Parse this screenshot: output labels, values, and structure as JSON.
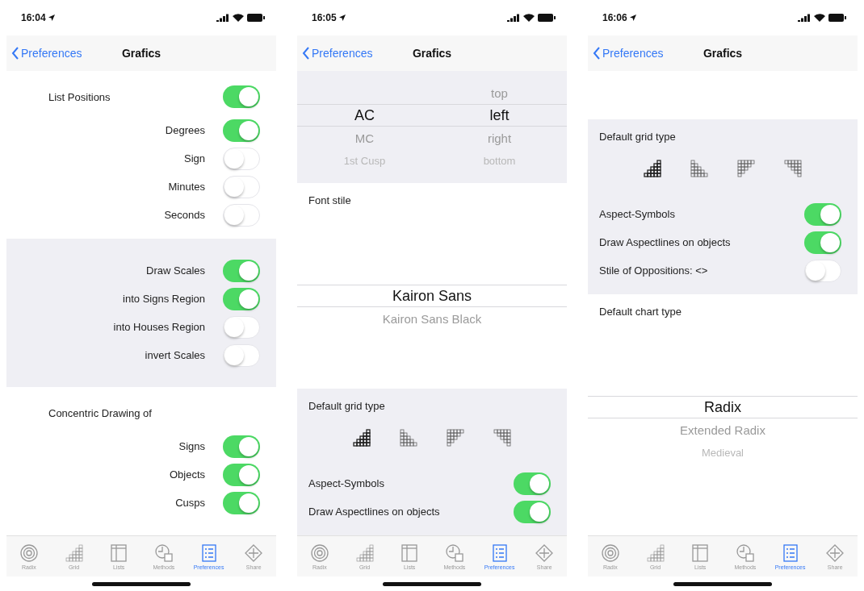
{
  "phones": [
    {
      "time": "16:04",
      "back": "Preferences",
      "title": "Grafics",
      "sections": [
        {
          "kind": "toggles",
          "shaded": false,
          "right_aligned": true,
          "heading": {
            "label": "List Positions",
            "on": true
          },
          "rows": [
            {
              "label": "Degrees",
              "on": true
            },
            {
              "label": "Sign",
              "on": false
            },
            {
              "label": "Minutes",
              "on": false
            },
            {
              "label": "Seconds",
              "on": false
            }
          ]
        },
        {
          "kind": "toggles",
          "shaded": true,
          "right_aligned": true,
          "rows": [
            {
              "label": "Draw Scales",
              "on": true
            },
            {
              "label": "into Signs Region",
              "on": true
            },
            {
              "label": "into Houses Region",
              "on": false
            },
            {
              "label": "invert Scales",
              "on": false
            }
          ]
        },
        {
          "kind": "toggles",
          "shaded": false,
          "right_aligned": true,
          "heading": {
            "label": "Concentric Drawing of"
          },
          "rows": [
            {
              "label": "Signs",
              "on": true
            },
            {
              "label": "Objects",
              "on": true
            },
            {
              "label": "Cusps",
              "on": true
            }
          ]
        }
      ],
      "tabs": [
        {
          "label": "Radix",
          "selected": false
        },
        {
          "label": "Grid",
          "selected": false
        },
        {
          "label": "Lists",
          "selected": false
        },
        {
          "label": "Methods",
          "selected": false
        },
        {
          "label": "Preferences",
          "selected": true
        },
        {
          "label": "Share",
          "selected": false
        }
      ]
    },
    {
      "time": "16:05",
      "back": "Preferences",
      "title": "Grafics",
      "sections": [
        {
          "kind": "picker",
          "shaded": true,
          "columns": [
            [
              {
                "label": "AC",
                "selected": true
              },
              {
                "label": "MC",
                "selected": false
              },
              {
                "label": "1st Cusp",
                "selected": false
              }
            ],
            [
              {
                "label": "top",
                "selected": false
              },
              {
                "label": "left",
                "selected": true
              },
              {
                "label": "right",
                "selected": false
              },
              {
                "label": "bottom",
                "selected": false
              }
            ]
          ]
        },
        {
          "kind": "picker",
          "shaded": false,
          "heading": "Font stile",
          "columns": [
            [
              {
                "label": "Kairon Sans",
                "selected": true
              },
              {
                "label": "Kairon Sans Black",
                "selected": false
              }
            ]
          ]
        },
        {
          "kind": "grid",
          "shaded": true,
          "heading": "Default grid type",
          "grid_types": [
            {
              "selected": true
            },
            {
              "selected": false
            },
            {
              "selected": false
            },
            {
              "selected": false
            }
          ],
          "rows": [
            {
              "label": "Aspect-Symbols",
              "on": true
            },
            {
              "label": "Draw Aspectlines on objects",
              "on": true
            }
          ]
        }
      ],
      "tabs": [
        {
          "label": "Radix",
          "selected": false
        },
        {
          "label": "Grid",
          "selected": false
        },
        {
          "label": "Lists",
          "selected": false
        },
        {
          "label": "Methods",
          "selected": false
        },
        {
          "label": "Preferences",
          "selected": true
        },
        {
          "label": "Share",
          "selected": false
        }
      ]
    },
    {
      "time": "16:06",
      "back": "Preferences",
      "title": "Grafics",
      "sections": [
        {
          "kind": "grid",
          "shaded": true,
          "heading": "Default grid type",
          "grid_types": [
            {
              "selected": true
            },
            {
              "selected": false
            },
            {
              "selected": false
            },
            {
              "selected": false
            }
          ],
          "rows": [
            {
              "label": "Aspect-Symbols",
              "on": true
            },
            {
              "label": "Draw Aspectlines on objects",
              "on": true
            },
            {
              "label": "Stile of Oppositions: <>",
              "on": false
            }
          ]
        },
        {
          "kind": "picker",
          "shaded": false,
          "heading": "Default chart type",
          "columns": [
            [
              {
                "label": "Radix",
                "selected": true
              },
              {
                "label": "Extended Radix",
                "selected": false
              },
              {
                "label": "Medieval",
                "selected": false
              }
            ]
          ]
        }
      ],
      "tabs": [
        {
          "label": "Radix",
          "selected": false
        },
        {
          "label": "Grid",
          "selected": false
        },
        {
          "label": "Lists",
          "selected": false
        },
        {
          "label": "Methods",
          "selected": false
        },
        {
          "label": "Preferences",
          "selected": true
        },
        {
          "label": "Share",
          "selected": false
        }
      ]
    }
  ]
}
